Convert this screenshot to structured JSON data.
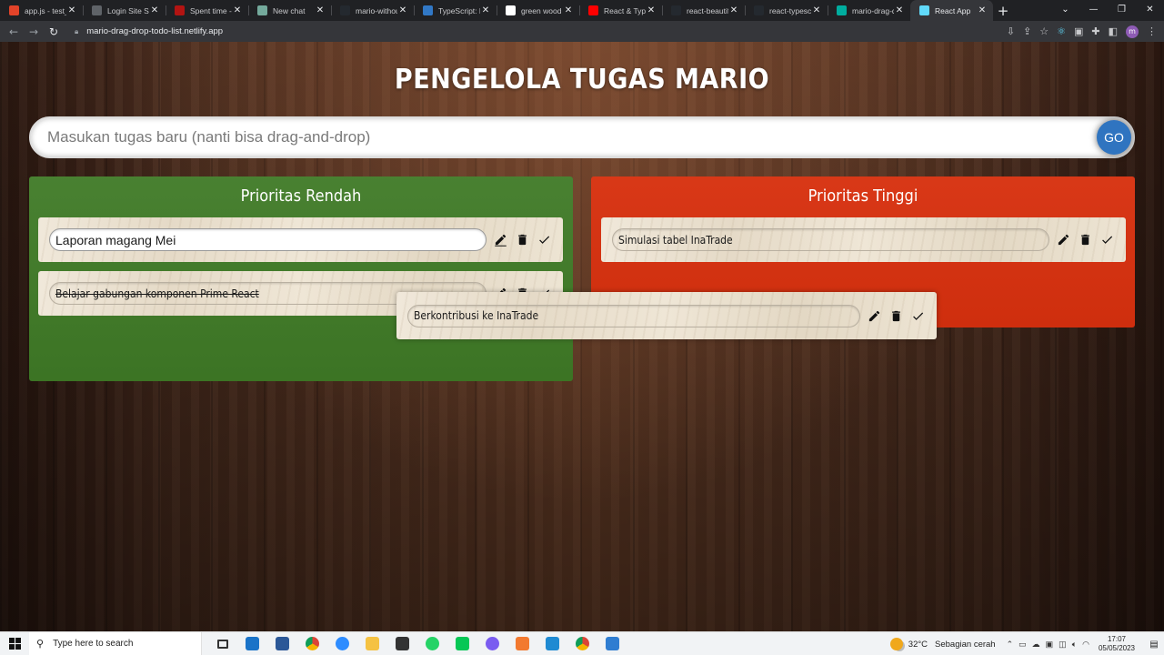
{
  "browser": {
    "tabs": [
      {
        "title": "app.js - test_b",
        "fav_color": "#e24329",
        "active": false
      },
      {
        "title": "Login Site Su",
        "fav_color": "#5f6368",
        "active": false
      },
      {
        "title": "Spent time - (",
        "fav_color": "#b31412",
        "active": false
      },
      {
        "title": "New chat",
        "fav_color": "#74aa9c",
        "active": false
      },
      {
        "title": "mario-withou",
        "fav_color": "#24292f",
        "active": false
      },
      {
        "title": "TypeScript: D",
        "fav_color": "#3178c6",
        "active": false
      },
      {
        "title": "green wood",
        "fav_color": "#ffffff",
        "active": false
      },
      {
        "title": "React & Type",
        "fav_color": "#ff0000",
        "active": false
      },
      {
        "title": "react-beautif",
        "fav_color": "#24292f",
        "active": false
      },
      {
        "title": "react-typescr",
        "fav_color": "#24292f",
        "active": false
      },
      {
        "title": "mario-drag-d",
        "fav_color": "#00ad9f",
        "active": false
      },
      {
        "title": "React App",
        "fav_color": "#61dafb",
        "active": true
      }
    ],
    "url": "mario-drag-drop-todo-list.netlify.app",
    "profile_initial": "m"
  },
  "app": {
    "title": "PENGELOLA TUGAS MARIO",
    "input_placeholder": "Masukan tugas baru (nanti bisa drag-and-drop)",
    "go_label": "GO",
    "columns": {
      "low": {
        "heading": "Prioritas Rendah",
        "color": "#3f7a26",
        "tasks": [
          {
            "text": "Laporan magang Mei",
            "state": "editing"
          },
          {
            "text": "Belajar gabungan komponen Prime React",
            "state": "done"
          }
        ]
      },
      "high": {
        "heading": "Prioritas Tinggi",
        "color": "#d7300e",
        "tasks": [
          {
            "text": "Simulasi tabel InaTrade",
            "state": "normal"
          }
        ]
      }
    },
    "dragging_task": {
      "text": "Berkontribusi ke InaTrade",
      "state": "dragging"
    }
  },
  "taskbar": {
    "search_placeholder": "Type here to search",
    "weather_temp": "32°C",
    "weather_condition": "Sebagian cerah",
    "time": "17:07",
    "date": "05/05/2023"
  }
}
